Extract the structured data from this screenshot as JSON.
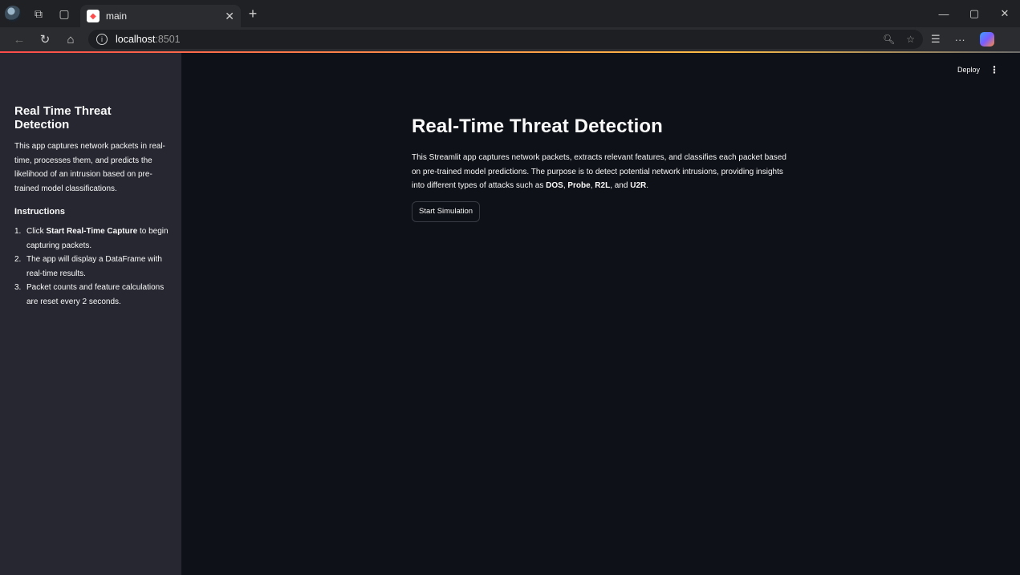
{
  "browser": {
    "tab_title": "main",
    "url_host": "localhost",
    "url_port": ":8501"
  },
  "app": {
    "deploy_label": "Deploy",
    "menu_glyph": "⋮"
  },
  "sidebar": {
    "title": "Real Time Threat Detection",
    "description": "This app captures network packets in real-time, processes them, and predicts the likelihood of an intrusion based on pre-trained model classifications.",
    "instructions_heading": "Instructions",
    "instructions": [
      {
        "num": "1.",
        "pre": "Click ",
        "bold": "Start Real-Time Capture",
        "post": " to begin capturing packets."
      },
      {
        "num": "2.",
        "pre": "The app will display a DataFrame with real-time results.",
        "bold": "",
        "post": ""
      },
      {
        "num": "3.",
        "pre": "Packet counts and feature calculations are reset every 2 seconds.",
        "bold": "",
        "post": ""
      }
    ]
  },
  "main": {
    "title": "Real-Time Threat Detection",
    "desc_text": "This Streamlit app captures network packets, extracts relevant features, and classifies each packet based on pre-trained model predictions. The purpose is to detect potential network intrusions, providing insights into different types of attacks such as ",
    "attack_1": "DOS",
    "sep_1": ", ",
    "attack_2": "Probe",
    "sep_2": ", ",
    "attack_3": "R2L",
    "sep_3": ", and ",
    "attack_4": "U2R",
    "end": ".",
    "button_label": "Start Simulation"
  },
  "colors": {
    "sidebar_bg": "#262730",
    "main_bg": "#0e1117",
    "accent": "#ff4b4b"
  }
}
